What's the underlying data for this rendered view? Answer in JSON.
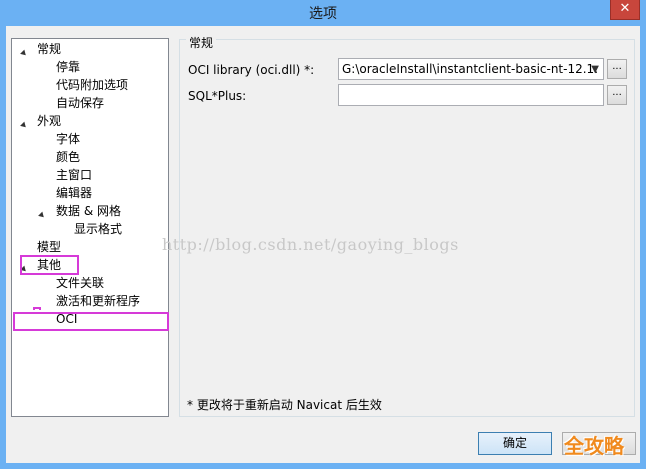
{
  "window": {
    "title": "选项",
    "close_glyph": "✕"
  },
  "tree": {
    "items": [
      {
        "label": "常规",
        "level": 0,
        "expanded": true
      },
      {
        "label": "停靠",
        "level": 1
      },
      {
        "label": "代码附加选项",
        "level": 1
      },
      {
        "label": "自动保存",
        "level": 1
      },
      {
        "label": "外观",
        "level": 0,
        "expanded": true
      },
      {
        "label": "字体",
        "level": 1
      },
      {
        "label": "颜色",
        "level": 1
      },
      {
        "label": "主窗口",
        "level": 1
      },
      {
        "label": "编辑器",
        "level": 1
      },
      {
        "label": "数据 & 网格",
        "level": 1,
        "expanded": true
      },
      {
        "label": "显示格式",
        "level": 2
      },
      {
        "label": "模型",
        "level": 0
      },
      {
        "label": "其他",
        "level": 0,
        "expanded": true
      },
      {
        "label": "文件关联",
        "level": 1
      },
      {
        "label": "激活和更新程序",
        "level": 1
      },
      {
        "label": "OCI",
        "level": 1,
        "selected": true
      }
    ]
  },
  "panel": {
    "group_title": "常规",
    "oci_label": "OCI library (oci.dll) *:",
    "oci_value": "G:\\oracleInstall\\instantclient-basic-nt-12.1.",
    "sqlplus_label": "SQL*Plus:",
    "sqlplus_value": "",
    "browse_label": "...",
    "note": "* 更改将于重新启动 Navicat 后生效"
  },
  "watermark": "http://blog.csdn.net/gaoying_blogs",
  "buttons": {
    "ok": "确定"
  },
  "logo_text": "全攻略",
  "colors": {
    "highlight": "#d63ad8",
    "titlebar": "#6bb1f3",
    "logo": "#f08a1e"
  }
}
